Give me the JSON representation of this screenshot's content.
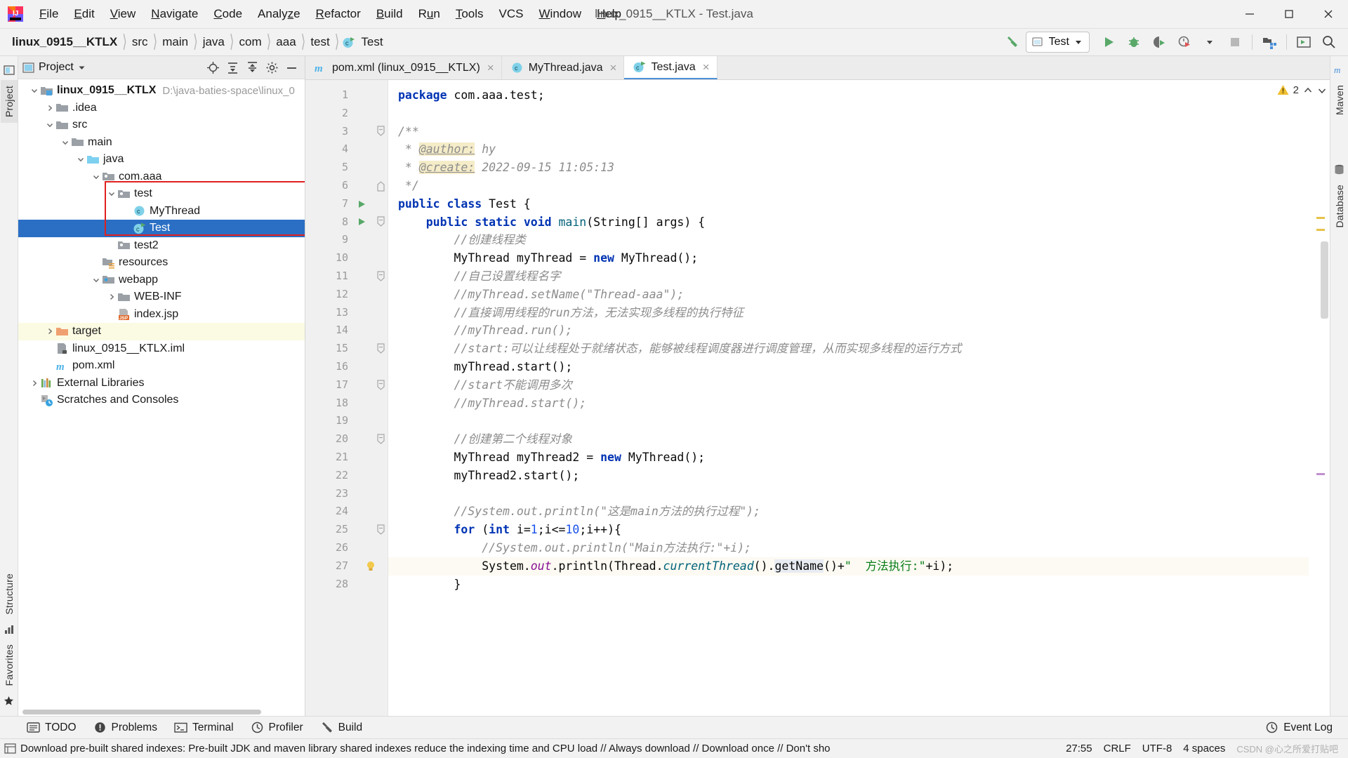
{
  "window": {
    "title": "linux_0915__KTLX - Test.java",
    "controls": [
      "minimize",
      "maximize",
      "close"
    ]
  },
  "menubar": {
    "items": [
      {
        "label": "File",
        "mnemonic": "F"
      },
      {
        "label": "Edit",
        "mnemonic": "E"
      },
      {
        "label": "View",
        "mnemonic": "V"
      },
      {
        "label": "Navigate",
        "mnemonic": "N"
      },
      {
        "label": "Code",
        "mnemonic": "C"
      },
      {
        "label": "Analyze",
        "mnemonic": "z"
      },
      {
        "label": "Refactor",
        "mnemonic": "R"
      },
      {
        "label": "Build",
        "mnemonic": "B"
      },
      {
        "label": "Run",
        "mnemonic": "u"
      },
      {
        "label": "Tools",
        "mnemonic": "T"
      },
      {
        "label": "VCS",
        "mnemonic": ""
      },
      {
        "label": "Window",
        "mnemonic": "W"
      },
      {
        "label": "Help",
        "mnemonic": "H"
      }
    ]
  },
  "navbar": {
    "breadcrumbs": [
      "linux_0915__KTLX",
      "src",
      "main",
      "java",
      "com",
      "aaa",
      "test",
      "Test"
    ],
    "run_config": "Test",
    "buttons": [
      "build-hammer",
      "run",
      "debug",
      "run-with-coverage",
      "profiler",
      "stop",
      "project-structure",
      "terminal-window",
      "search-everywhere"
    ]
  },
  "left_rail": {
    "tabs": [
      "Project",
      "Structure",
      "Favorites"
    ]
  },
  "right_rail": {
    "tabs": [
      "Maven",
      "Database"
    ]
  },
  "project_panel": {
    "title": "Project",
    "header_buttons": [
      "locate",
      "expand-all",
      "collapse-all",
      "settings",
      "hide"
    ],
    "tree": [
      {
        "label": "linux_0915__KTLX",
        "path": "D:\\java-baties-space\\linux_0",
        "depth": 0,
        "arrow": "down",
        "icon": "module-folder",
        "bold": true,
        "state": "normal"
      },
      {
        "label": ".idea",
        "depth": 1,
        "arrow": "right",
        "icon": "folder",
        "state": "normal"
      },
      {
        "label": "src",
        "depth": 1,
        "arrow": "down",
        "icon": "folder",
        "state": "normal"
      },
      {
        "label": "main",
        "depth": 2,
        "arrow": "down",
        "icon": "folder",
        "state": "normal"
      },
      {
        "label": "java",
        "depth": 3,
        "arrow": "down",
        "icon": "source-folder",
        "state": "normal"
      },
      {
        "label": "com.aaa",
        "depth": 4,
        "arrow": "down",
        "icon": "package",
        "state": "normal"
      },
      {
        "label": "test",
        "depth": 5,
        "arrow": "down",
        "icon": "package",
        "state": "normal"
      },
      {
        "label": "MyThread",
        "depth": 6,
        "arrow": "none",
        "icon": "class",
        "state": "normal"
      },
      {
        "label": "Test",
        "depth": 6,
        "arrow": "none",
        "icon": "runnable-class",
        "state": "selected"
      },
      {
        "label": "test2",
        "depth": 5,
        "arrow": "none",
        "icon": "package",
        "state": "normal"
      },
      {
        "label": "resources",
        "depth": 4,
        "arrow": "none",
        "icon": "resources-folder",
        "state": "normal"
      },
      {
        "label": "webapp",
        "depth": 4,
        "arrow": "down",
        "icon": "web-folder",
        "state": "normal"
      },
      {
        "label": "WEB-INF",
        "depth": 5,
        "arrow": "right",
        "icon": "folder",
        "state": "normal"
      },
      {
        "label": "index.jsp",
        "depth": 5,
        "arrow": "none",
        "icon": "jsp-file",
        "state": "normal"
      },
      {
        "label": "target",
        "depth": 1,
        "arrow": "right",
        "icon": "excluded-folder",
        "state": "highlight"
      },
      {
        "label": "linux_0915__KTLX.iml",
        "depth": 1,
        "arrow": "none",
        "icon": "iml-file",
        "state": "normal"
      },
      {
        "label": "pom.xml",
        "depth": 1,
        "arrow": "none",
        "icon": "maven-file",
        "state": "normal"
      },
      {
        "label": "External Libraries",
        "depth": 0,
        "arrow": "right",
        "icon": "libraries",
        "state": "normal"
      },
      {
        "label": "Scratches and Consoles",
        "depth": 0,
        "arrow": "none",
        "icon": "scratches",
        "state": "normal"
      }
    ]
  },
  "editor": {
    "tabs": [
      {
        "label": "pom.xml (linux_0915__KTLX)",
        "icon": "maven-file",
        "active": false,
        "closable": true
      },
      {
        "label": "MyThread.java",
        "icon": "class",
        "active": false,
        "closable": true
      },
      {
        "label": "Test.java",
        "icon": "runnable-class",
        "active": true,
        "closable": true
      }
    ],
    "warning_count": "2",
    "lines": [
      {
        "n": "1",
        "tokens": [
          {
            "t": "package ",
            "c": "kw"
          },
          {
            "t": "com.aaa.test;",
            "c": ""
          }
        ]
      },
      {
        "n": "2",
        "tokens": []
      },
      {
        "n": "3",
        "fold": "start",
        "tokens": [
          {
            "t": "/**",
            "c": "jdoc"
          }
        ]
      },
      {
        "n": "4",
        "tokens": [
          {
            "t": " * ",
            "c": "jdoc"
          },
          {
            "t": "@author:",
            "c": "jdoc-tag"
          },
          {
            "t": " hy",
            "c": "jdoc"
          }
        ]
      },
      {
        "n": "5",
        "tokens": [
          {
            "t": " * ",
            "c": "jdoc"
          },
          {
            "t": "@create:",
            "c": "jdoc-tag"
          },
          {
            "t": " 2022-09-15 11:05:13",
            "c": "jdoc"
          }
        ]
      },
      {
        "n": "6",
        "fold": "end",
        "tokens": [
          {
            "t": " */",
            "c": "jdoc"
          }
        ]
      },
      {
        "n": "7",
        "run": true,
        "tokens": [
          {
            "t": "public class ",
            "c": "kw"
          },
          {
            "t": "Test {",
            "c": ""
          }
        ]
      },
      {
        "n": "8",
        "run": true,
        "fold": "start",
        "tokens": [
          {
            "t": "    ",
            "c": ""
          },
          {
            "t": "public static void ",
            "c": "kw"
          },
          {
            "t": "main",
            "c": "mth"
          },
          {
            "t": "(String[] args) {",
            "c": ""
          }
        ]
      },
      {
        "n": "9",
        "tokens": [
          {
            "t": "        //创建线程类",
            "c": "cmt"
          }
        ]
      },
      {
        "n": "10",
        "tokens": [
          {
            "t": "        MyThread myThread = ",
            "c": ""
          },
          {
            "t": "new ",
            "c": "kw"
          },
          {
            "t": "MyThread();",
            "c": ""
          }
        ]
      },
      {
        "n": "11",
        "fold": "start",
        "tokens": [
          {
            "t": "        //自己设置线程名字",
            "c": "cmt"
          }
        ]
      },
      {
        "n": "12",
        "tokens": [
          {
            "t": "        //myThread.setName(\"Thread-aaa\");",
            "c": "cmt"
          }
        ]
      },
      {
        "n": "13",
        "tokens": [
          {
            "t": "        //直接调用线程的run方法，无法实现多线程的执行特征",
            "c": "cmt"
          }
        ]
      },
      {
        "n": "14",
        "tokens": [
          {
            "t": "        //myThread.run();",
            "c": "cmt"
          }
        ]
      },
      {
        "n": "15",
        "fold": "start",
        "tokens": [
          {
            "t": "        //start:可以让线程处于就绪状态，能够被线程调度器进行调度管理，从而实现多线程的运行方式",
            "c": "cmt"
          }
        ]
      },
      {
        "n": "16",
        "tokens": [
          {
            "t": "        myThread.start();",
            "c": ""
          }
        ]
      },
      {
        "n": "17",
        "fold": "start",
        "tokens": [
          {
            "t": "        //start不能调用多次",
            "c": "cmt"
          }
        ]
      },
      {
        "n": "18",
        "tokens": [
          {
            "t": "        //myThread.start();",
            "c": "cmt"
          }
        ]
      },
      {
        "n": "19",
        "tokens": []
      },
      {
        "n": "20",
        "fold": "start",
        "tokens": [
          {
            "t": "        //创建第二个线程对象",
            "c": "cmt"
          }
        ]
      },
      {
        "n": "21",
        "tokens": [
          {
            "t": "        MyThread myThread2 = ",
            "c": ""
          },
          {
            "t": "new ",
            "c": "kw"
          },
          {
            "t": "MyThread();",
            "c": ""
          }
        ]
      },
      {
        "n": "22",
        "tokens": [
          {
            "t": "        myThread2.start();",
            "c": ""
          }
        ]
      },
      {
        "n": "23",
        "tokens": []
      },
      {
        "n": "24",
        "tokens": [
          {
            "t": "        //System.out.println(\"这是main方法的执行过程\");",
            "c": "cmt"
          }
        ]
      },
      {
        "n": "25",
        "fold": "start",
        "tokens": [
          {
            "t": "        ",
            "c": ""
          },
          {
            "t": "for ",
            "c": "kw"
          },
          {
            "t": "(",
            "c": ""
          },
          {
            "t": "int ",
            "c": "kw"
          },
          {
            "t": "i=",
            "c": ""
          },
          {
            "t": "1",
            "c": "num"
          },
          {
            "t": ";i<=",
            "c": ""
          },
          {
            "t": "10",
            "c": "num"
          },
          {
            "t": ";i++){",
            "c": ""
          }
        ]
      },
      {
        "n": "26",
        "tokens": [
          {
            "t": "            //System.out.println(\"Main方法执行:\"+i);",
            "c": "cmt"
          }
        ]
      },
      {
        "n": "27",
        "bulb": true,
        "current": true,
        "tokens": [
          {
            "t": "            System.",
            "c": ""
          },
          {
            "t": "out",
            "c": "fld"
          },
          {
            "t": ".println(Thread.",
            "c": ""
          },
          {
            "t": "currentThread",
            "c": "mth-i"
          },
          {
            "t": "().",
            "c": ""
          },
          {
            "t": "getName",
            "c": "hl-soft"
          },
          {
            "t": "()+",
            "c": ""
          },
          {
            "t": "\"  方法执行:\"",
            "c": "str"
          },
          {
            "t": "+i);",
            "c": ""
          }
        ]
      },
      {
        "n": "28",
        "tokens": [
          {
            "t": "        }",
            "c": ""
          }
        ]
      }
    ]
  },
  "bottom_bar": {
    "items": [
      {
        "label": "TODO",
        "icon": "todo-icon"
      },
      {
        "label": "Problems",
        "icon": "problems-icon"
      },
      {
        "label": "Terminal",
        "icon": "terminal-icon"
      },
      {
        "label": "Profiler",
        "icon": "profiler-icon"
      },
      {
        "label": "Build",
        "icon": "build-icon"
      }
    ],
    "event_log": "Event Log"
  },
  "status_bar": {
    "message": "Download pre-built shared indexes: Pre-built JDK and maven library shared indexes reduce the indexing time and CPU load // Always download // Download once // Don't sho",
    "caret": "27:55",
    "line_separator": "CRLF",
    "encoding": "UTF-8",
    "indent": "4 spaces",
    "watermark": "CSDN @心之所爱打贴吧"
  }
}
